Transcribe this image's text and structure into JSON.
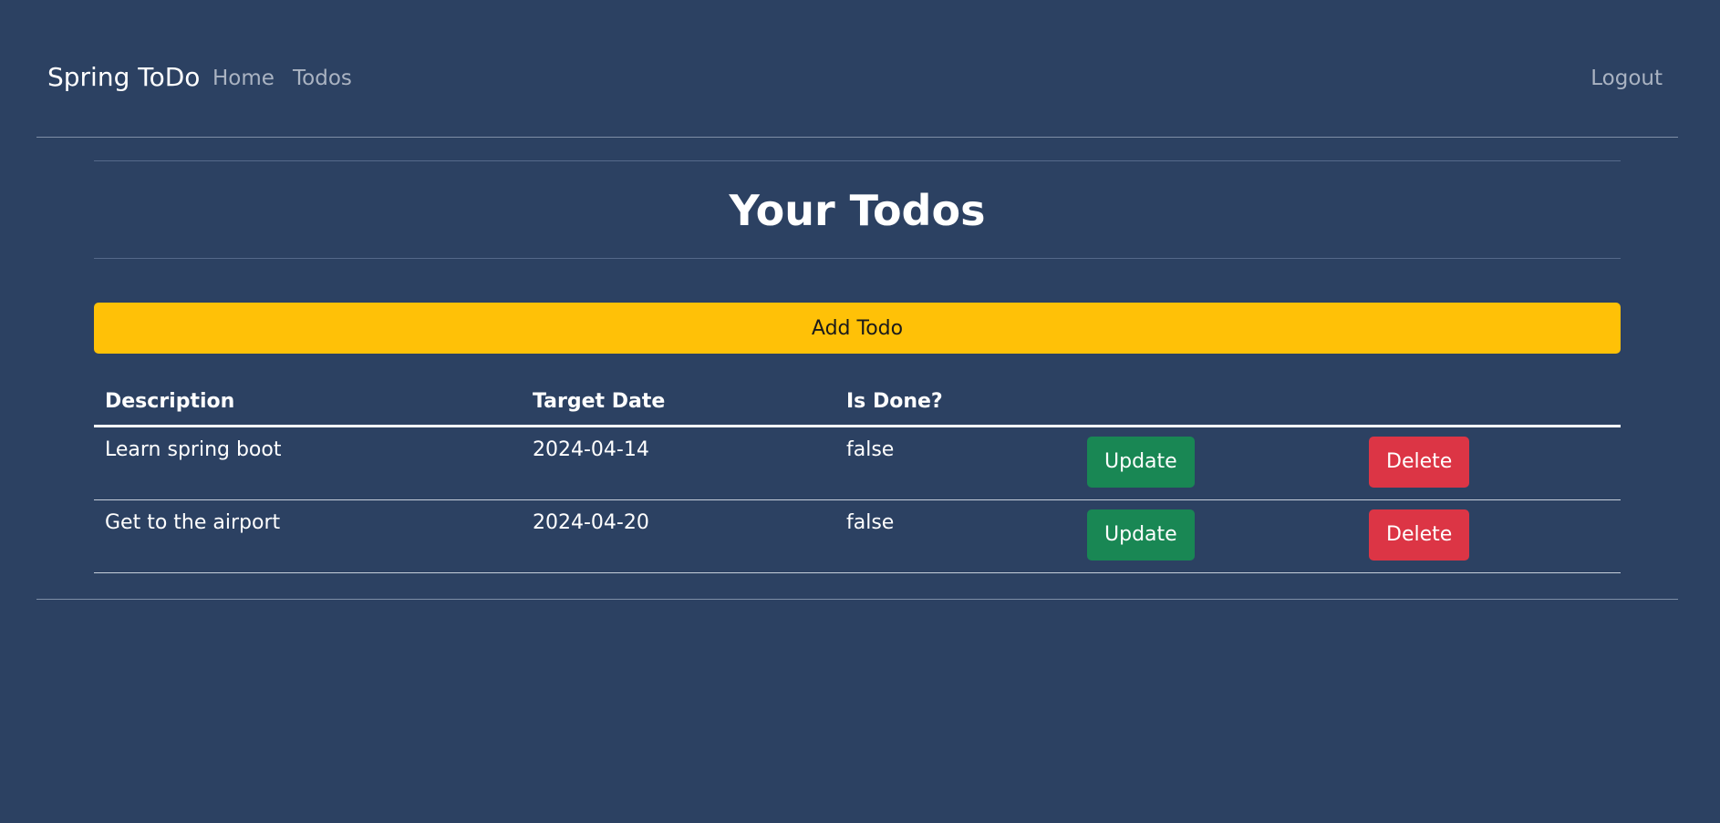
{
  "navbar": {
    "brand": "Spring ToDo",
    "home": "Home",
    "todos": "Todos",
    "logout": "Logout"
  },
  "main": {
    "title": "Your Todos",
    "add_button": "Add Todo"
  },
  "table": {
    "headers": [
      "Description",
      "Target Date",
      "Is Done?",
      "",
      ""
    ],
    "rows": [
      {
        "description": "Learn spring boot",
        "target_date": "2024-04-14",
        "is_done": "false",
        "update_label": "Update",
        "delete_label": "Delete"
      },
      {
        "description": "Get to the airport",
        "target_date": "2024-04-20",
        "is_done": "false",
        "update_label": "Update",
        "delete_label": "Delete"
      }
    ]
  },
  "colors": {
    "background": "#2c4162",
    "add_button": "#ffc107",
    "update_button": "#198754",
    "delete_button": "#dc3545"
  }
}
